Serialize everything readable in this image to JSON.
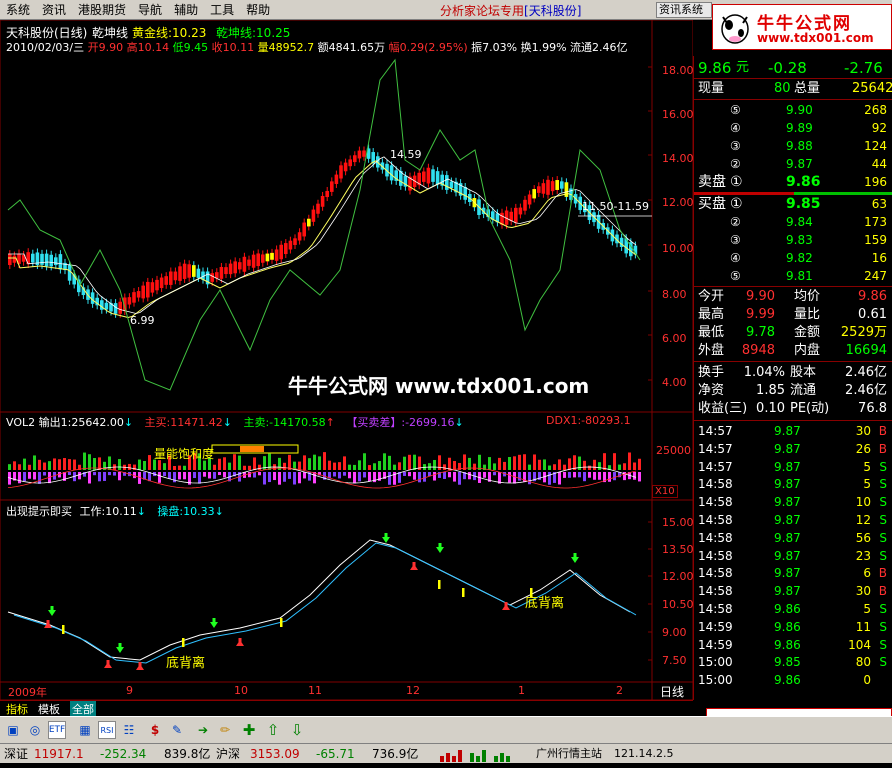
{
  "menu": {
    "items": [
      "系统",
      "资讯",
      "港股期货",
      "导航",
      "辅助",
      "工具",
      "帮助"
    ],
    "promo": "分析家论坛专用",
    "promo_brand": "[天科股份]",
    "sys_btn": "资讯系统"
  },
  "logo": {
    "title": "牛牛公式网",
    "url": "www.tdx001.com"
  },
  "watermark": "牛牛公式网  www.tdx001.com",
  "main_chart": {
    "header": {
      "name": "天科股份(日线)",
      "indicator": "乾坤线",
      "gold_label": "黄金线:10.23",
      "qk_label": "乾坤线:10.25"
    },
    "info": {
      "date": "2010/02/03/三",
      "open": "开9.90",
      "high": "高10.14",
      "low": "低9.45",
      "close": "收10.11",
      "vol": "量48952.7",
      "amount": "额4841.65万",
      "change": "幅0.29(2.95%)",
      "swing": "振7.03%",
      "turnover": "换1.99%",
      "float": "流通2.46亿"
    },
    "annotations": {
      "low": "6.99",
      "high": "14.59",
      "right": "11.50-11.59"
    },
    "yticks": [
      "18.00",
      "16.00",
      "14.00",
      "12.00",
      "10.00",
      "8.00",
      "6.00",
      "4.00"
    ]
  },
  "vol_chart": {
    "title": "VOL2",
    "out": "输出1:25642.00",
    "zm": "主买:11471.42",
    "zs": "主卖:-14170.58",
    "mmc": "【买卖差】:-2699.16",
    "ddx": "DDX1:-80293.1",
    "label": "量能饱和度",
    "ytick": "25000",
    "scale": "X10"
  },
  "sig_chart": {
    "title": "出现提示即买",
    "work": "工作:10.11",
    "op": "操盘:10.33",
    "div1": "底背离",
    "div2": "底背离",
    "yticks": [
      "15.00",
      "13.50",
      "12.00",
      "10.50",
      "9.00",
      "7.50"
    ]
  },
  "time_axis": {
    "labels": [
      "2009年",
      "9",
      "10",
      "11",
      "12",
      "1",
      "2"
    ],
    "period": "日线"
  },
  "quote": {
    "price": "9.86",
    "unit": "元",
    "change": "-0.28",
    "change2": "-2.76",
    "now_label": "现量",
    "now": "80",
    "total_label": "总量",
    "total": "25642",
    "asks": [
      {
        "n": "⑤",
        "p": "9.90",
        "v": "268"
      },
      {
        "n": "④",
        "p": "9.89",
        "v": "92"
      },
      {
        "n": "③",
        "p": "9.88",
        "v": "124"
      },
      {
        "n": "②",
        "p": "9.87",
        "v": "44"
      }
    ],
    "sell1": {
      "label": "卖盘",
      "n": "①",
      "p": "9.86",
      "v": "196"
    },
    "buy1": {
      "label": "买盘",
      "n": "①",
      "p": "9.85",
      "v": "63"
    },
    "bids": [
      {
        "n": "②",
        "p": "9.84",
        "v": "173"
      },
      {
        "n": "③",
        "p": "9.83",
        "v": "159"
      },
      {
        "n": "④",
        "p": "9.82",
        "v": "16"
      },
      {
        "n": "⑤",
        "p": "9.81",
        "v": "247"
      }
    ],
    "stats": [
      {
        "a": "今开",
        "av": "9.90",
        "b": "均价",
        "bv": "9.86"
      },
      {
        "a": "最高",
        "av": "9.99",
        "b": "量比",
        "bv": "0.61"
      },
      {
        "a": "最低",
        "av": "9.78",
        "b": "金额",
        "bv": "2529万"
      },
      {
        "a": "外盘",
        "av": "8948",
        "b": "内盘",
        "bv": "16694"
      }
    ],
    "fin": [
      {
        "a": "换手",
        "av": "1.04%",
        "b": "股本",
        "bv": "2.46亿"
      },
      {
        "a": "净资",
        "av": "1.85",
        "b": "流通",
        "bv": "2.46亿"
      },
      {
        "a": "收益(三)",
        "av": "0.10",
        "b": "PE(动)",
        "bv": "76.8"
      }
    ],
    "ticks": [
      {
        "t": "14:57",
        "p": "9.87",
        "v": "30",
        "s": "B"
      },
      {
        "t": "14:57",
        "p": "9.87",
        "v": "26",
        "s": "B"
      },
      {
        "t": "14:57",
        "p": "9.87",
        "v": "5",
        "s": "S"
      },
      {
        "t": "14:58",
        "p": "9.87",
        "v": "5",
        "s": "S"
      },
      {
        "t": "14:58",
        "p": "9.87",
        "v": "10",
        "s": "S"
      },
      {
        "t": "14:58",
        "p": "9.87",
        "v": "12",
        "s": "S"
      },
      {
        "t": "14:58",
        "p": "9.87",
        "v": "56",
        "s": "S"
      },
      {
        "t": "14:58",
        "p": "9.87",
        "v": "23",
        "s": "S"
      },
      {
        "t": "14:58",
        "p": "9.87",
        "v": "6",
        "s": "B"
      },
      {
        "t": "14:58",
        "p": "9.87",
        "v": "30",
        "s": "B"
      },
      {
        "t": "14:58",
        "p": "9.86",
        "v": "5",
        "s": "S"
      },
      {
        "t": "14:59",
        "p": "9.86",
        "v": "11",
        "s": "S"
      },
      {
        "t": "14:59",
        "p": "9.86",
        "v": "104",
        "s": "S"
      },
      {
        "t": "15:00",
        "p": "9.85",
        "v": "80",
        "s": "S"
      },
      {
        "t": "15:00",
        "p": "9.86",
        "v": "0",
        "s": ""
      }
    ]
  },
  "tabs": {
    "items": [
      "指标",
      "模板",
      "全部"
    ]
  },
  "status": {
    "sz_label": "深证",
    "sz": "11917.1",
    "sz_ch": "-252.34",
    "sz_amt": "839.8亿",
    "hs_label": "沪深",
    "hs": "3153.09",
    "hs_ch": "-65.71",
    "hs_amt": "736.9亿",
    "station": "广州行情主站",
    "ip": "121.14.2.5"
  }
}
